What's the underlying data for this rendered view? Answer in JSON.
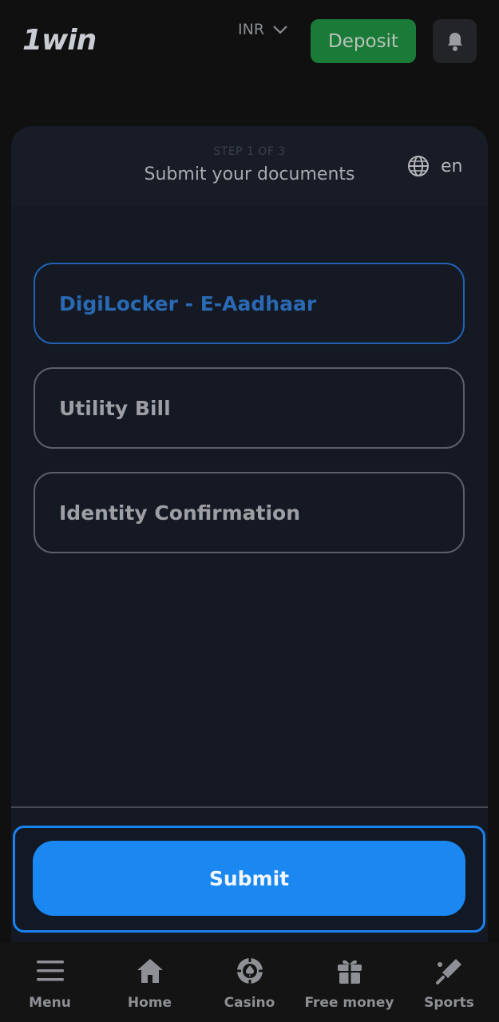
{
  "header": {
    "logo": "1win",
    "currency": "INR",
    "deposit_label": "Deposit"
  },
  "card": {
    "step": "STEP 1 OF 3",
    "title": "Submit your documents",
    "language": "en",
    "options": [
      {
        "label": "DigiLocker - E-Aadhaar",
        "selected": true
      },
      {
        "label": "Utility Bill",
        "selected": false
      },
      {
        "label": "Identity Confirmation",
        "selected": false
      }
    ],
    "submit_label": "Submit"
  },
  "bottom_nav": {
    "items": [
      {
        "label": "Menu",
        "icon": "menu-icon"
      },
      {
        "label": "Home",
        "icon": "home-icon"
      },
      {
        "label": "Casino",
        "icon": "casino-chip-icon"
      },
      {
        "label": "Free money",
        "icon": "gift-icon"
      },
      {
        "label": "Sports",
        "icon": "sports-icon"
      }
    ]
  },
  "colors": {
    "accent": "#1a88f0",
    "deposit": "#1a7a37",
    "selected_border": "#2162b3"
  }
}
